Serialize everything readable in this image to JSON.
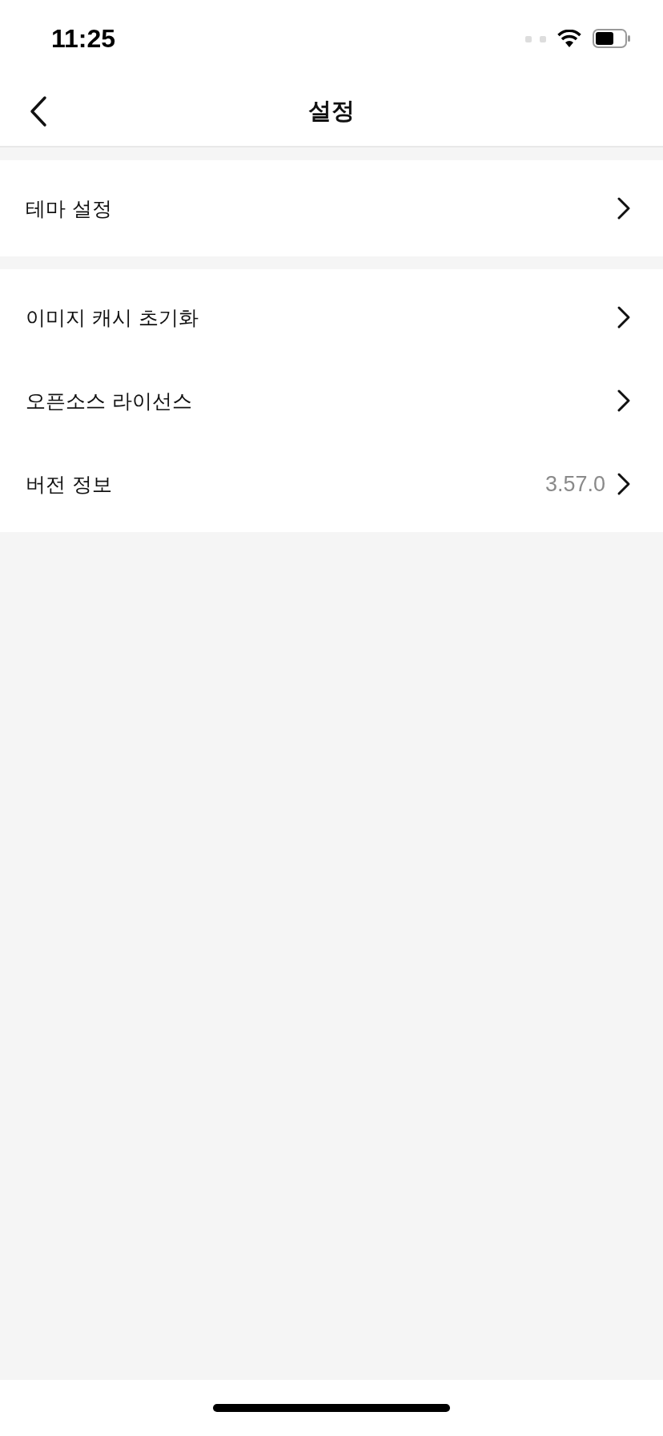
{
  "status_bar": {
    "time": "11:25"
  },
  "nav": {
    "title": "설정"
  },
  "sections": [
    {
      "items": [
        {
          "label": "테마 설정"
        }
      ]
    },
    {
      "items": [
        {
          "label": "이미지 캐시 초기화"
        },
        {
          "label": "오픈소스 라이선스"
        },
        {
          "label": "버전 정보",
          "value": "3.57.0"
        }
      ]
    }
  ]
}
